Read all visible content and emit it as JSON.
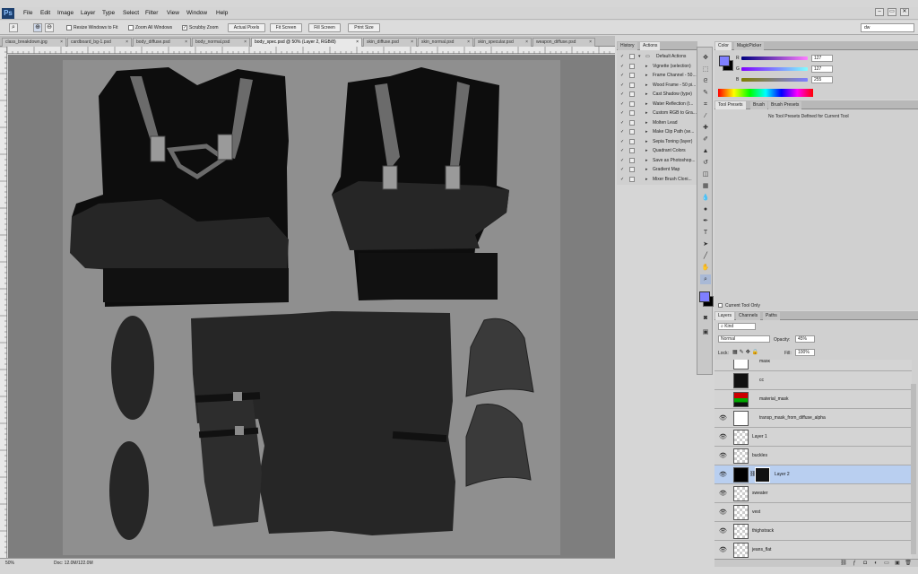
{
  "app": {
    "logo": "Ps"
  },
  "menu": [
    "File",
    "Edit",
    "Image",
    "Layer",
    "Type",
    "Select",
    "Filter",
    "View",
    "Window",
    "Help"
  ],
  "window_controls": [
    "–",
    "▭",
    "✕"
  ],
  "options": {
    "resize_windows": "Resize Windows to Fit",
    "zoom_all": "Zoom All Windows",
    "scrubby": "Scrubby Zoom",
    "buttons": [
      "Actual Pixels",
      "Fit Screen",
      "Fill Screen",
      "Print Size"
    ],
    "workspace": "dw"
  },
  "doc_tabs": [
    {
      "label": "class_breakdown.jpg"
    },
    {
      "label": "cardboard_bg-1.psd"
    },
    {
      "label": "body_diffuse.psd"
    },
    {
      "label": "body_normal.psd"
    },
    {
      "label": "body_spec.psd @ 50% (Layer 2, RGB/8)"
    },
    {
      "label": "skin_diffuse.psd"
    },
    {
      "label": "skin_normal.psd"
    },
    {
      "label": "skin_specular.psd"
    },
    {
      "label": "weapon_diffuse.psd"
    }
  ],
  "status": {
    "zoom": "50%",
    "doc": "Doc: 12.0M/122.0M"
  },
  "history_panel": {
    "tabs": [
      "History",
      "Actions"
    ],
    "actions": [
      "Default Actions",
      "Vignette (selection)",
      "Frame Channel - 50...",
      "Wood Frame - 50 pi...",
      "Cast Shadow (type)",
      "Water Reflection (t...",
      "Custom RGB to Gra...",
      "Molten Lead",
      "Make Clip Path (se...",
      "Sepia Toning (layer)",
      "Quadrant Colors",
      "Save as Photoshop...",
      "Gradient Map",
      "Mixer Brush Cloni..."
    ]
  },
  "color_panel": {
    "tabs": [
      "Color",
      "MagicPicker"
    ],
    "labels": [
      "R",
      "G",
      "B"
    ],
    "values": [
      "127",
      "127",
      "255"
    ],
    "fg": "#7f7fff",
    "bg": "#000000"
  },
  "tool_presets": {
    "tabs": [
      "Tool Presets",
      "Brush",
      "Brush Presets"
    ],
    "message": "No Tool Presets Defined for Current Tool",
    "current_only": "Current Tool Only"
  },
  "layers_panel": {
    "tabs": [
      "Layers",
      "Channels",
      "Paths"
    ],
    "kind": "Kind",
    "blend": "Normal",
    "opacity_label": "Opacity:",
    "opacity": "45%",
    "lock_label": "Lock:",
    "fill_label": "Fill:",
    "fill": "100%",
    "layers": [
      {
        "name": "mask"
      },
      {
        "name": "cc"
      },
      {
        "name": "material_mask"
      },
      {
        "name": "transp_mask_from_diffuse_alpha"
      },
      {
        "name": "Layer 1"
      },
      {
        "name": "buckles"
      },
      {
        "name": "Layer 2"
      },
      {
        "name": "sweater"
      },
      {
        "name": "vest"
      },
      {
        "name": "thighstrack"
      },
      {
        "name": "jeans_flat"
      }
    ]
  }
}
